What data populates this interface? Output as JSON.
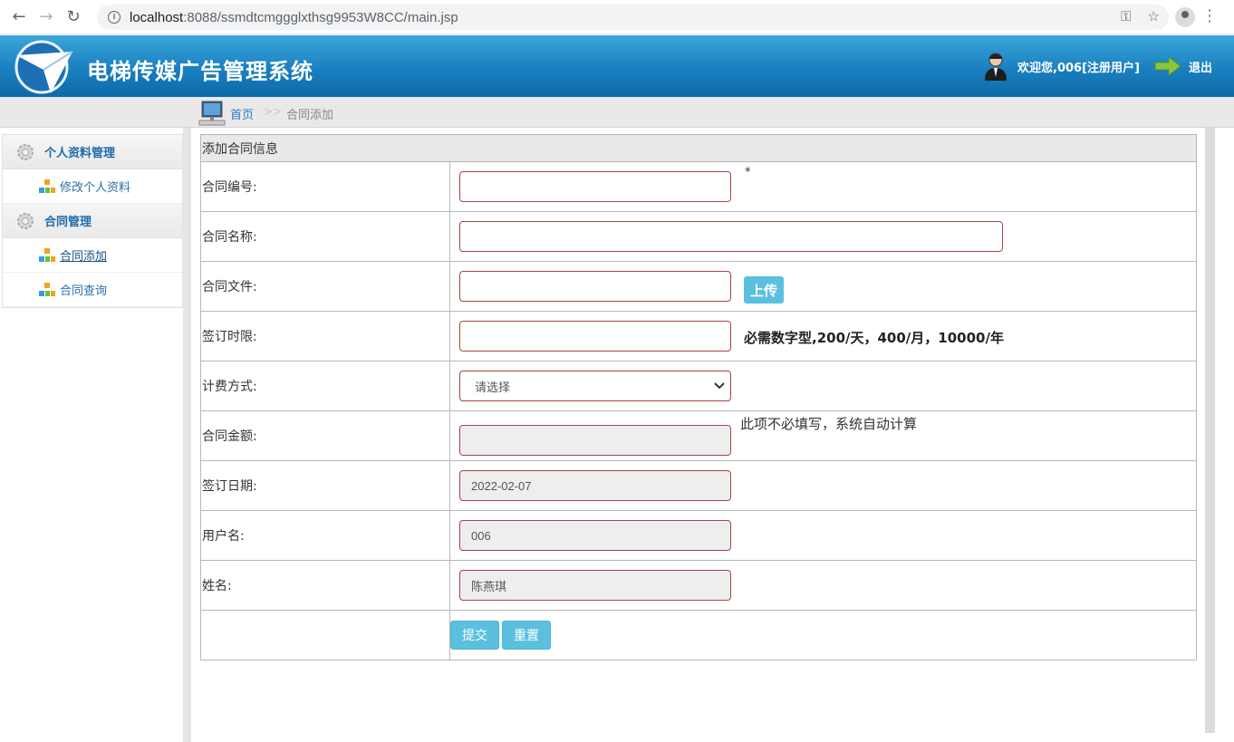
{
  "browser": {
    "url_host": "localhost",
    "url_rest": ":8088/ssmdtcmggglxthsg9953W8CC/main.jsp"
  },
  "header": {
    "title": "电梯传媒广告管理系统",
    "welcome": "欢迎您,006[注册用户]",
    "logout": "退出"
  },
  "breadcrumb": {
    "home": "首页",
    "sep": ">>",
    "current": "合同添加"
  },
  "sidebar": {
    "groups": [
      {
        "label": "个人资料管理",
        "items": [
          {
            "label": "修改个人资料"
          }
        ]
      },
      {
        "label": "合同管理",
        "items": [
          {
            "label": "合同添加"
          },
          {
            "label": "合同查询"
          }
        ]
      }
    ]
  },
  "form": {
    "heading": "添加合同信息",
    "fields": {
      "contract_no": {
        "label": "合同编号:",
        "value": "",
        "required_mark": "*"
      },
      "contract_name": {
        "label": "合同名称:",
        "value": ""
      },
      "contract_file": {
        "label": "合同文件:",
        "value": "",
        "upload": "上传"
      },
      "term": {
        "label": "签订时限:",
        "value": "",
        "hint": "必需数字型,200/天，400/月，10000/年"
      },
      "billing": {
        "label": "计费方式:",
        "selected": "请选择"
      },
      "amount": {
        "label": "合同金额:",
        "value": "",
        "hint": "此项不必填写，系统自动计算"
      },
      "sign_date": {
        "label": "签订日期:",
        "value": "2022-02-07"
      },
      "username": {
        "label": "用户名:",
        "value": "006"
      },
      "name": {
        "label": "姓名:",
        "value": "陈燕琪"
      }
    },
    "submit": "提交",
    "reset": "重置"
  }
}
